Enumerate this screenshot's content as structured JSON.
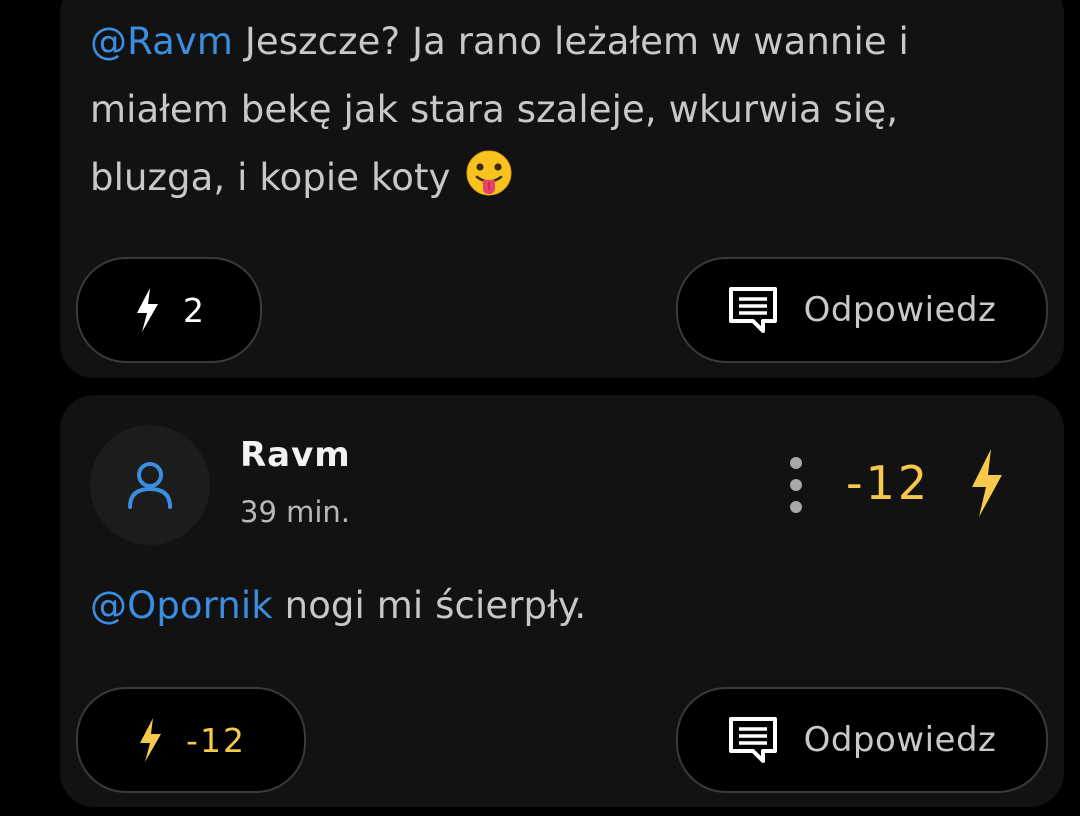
{
  "comments": [
    {
      "mention": "@Ravm",
      "line1": "Jeszcze? Ja rano leżałem w wannie i",
      "line2": "miałem bekę jak stara szaleje, wkurwia się,",
      "line3": "bluzga, i kopie koty",
      "emoji": "face-with-tongue-icon",
      "vote_count": "2",
      "reply_label": "Odpowiedz"
    },
    {
      "author": "Ravm",
      "time": "39 min.",
      "score": "-12",
      "mention": "@Opornik",
      "text": "nogi mi ścierpły.",
      "vote_count": "-12",
      "reply_label": "Odpowiedz"
    }
  ],
  "colors": {
    "background": "#000000",
    "card": "#121212",
    "mention": "#3b8de0",
    "negative_score": "#f6c84c",
    "text": "#c8c8c8"
  }
}
